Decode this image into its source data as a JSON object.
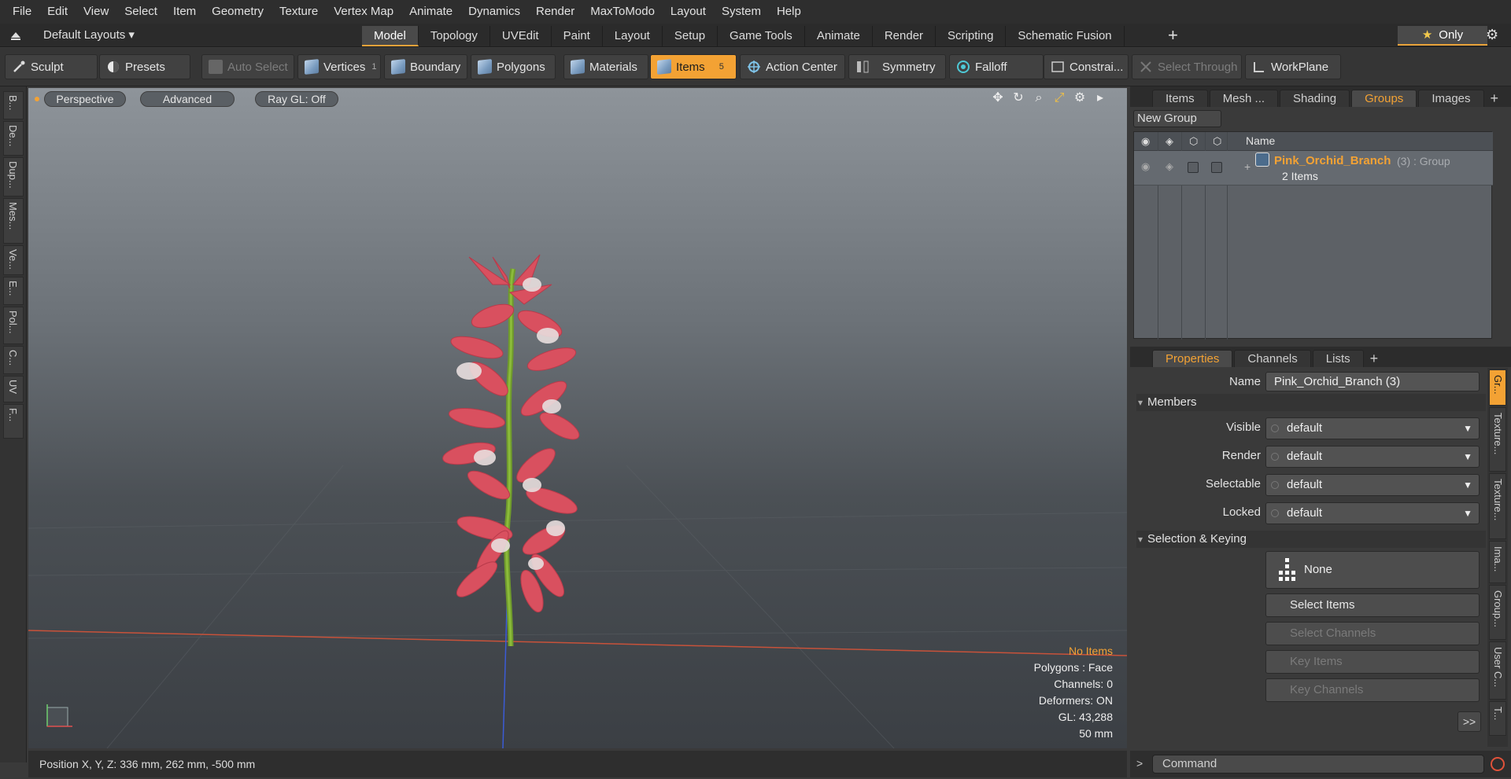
{
  "menubar": [
    "File",
    "Edit",
    "View",
    "Select",
    "Item",
    "Geometry",
    "Texture",
    "Vertex Map",
    "Animate",
    "Dynamics",
    "Render",
    "MaxToModo",
    "Layout",
    "System",
    "Help"
  ],
  "layouts": {
    "label": "Default Layouts ▾"
  },
  "layout_tabs": [
    "Model",
    "Topology",
    "UVEdit",
    "Paint",
    "Layout",
    "Setup",
    "Game Tools",
    "Animate",
    "Render",
    "Scripting",
    "Schematic Fusion"
  ],
  "layout_plus": "+",
  "only": {
    "label": "Only",
    "star": "★"
  },
  "toolbar": {
    "sculpt": "Sculpt",
    "presets": "Presets",
    "auto_select": "Auto Select",
    "vertices": "Vertices",
    "vertices_count": "1",
    "boundary": "Boundary",
    "polygons": "Polygons",
    "materials": "Materials",
    "items": "Items",
    "items_count": "5",
    "action_center": "Action Center",
    "symmetry": "Symmetry",
    "falloff": "Falloff",
    "constraints": "Constrai...",
    "select_through": "Select Through",
    "workplane": "WorkPlane"
  },
  "left_tabs": [
    "B...",
    "De...",
    "Dup...",
    "Mes...",
    "Ve...",
    "E...",
    "Pol...",
    "C...",
    "UV",
    "F..."
  ],
  "viewport": {
    "view": "Perspective",
    "style": "Advanced",
    "raygl": "Ray GL: Off",
    "info": {
      "warning": "No Items",
      "polygons": "Polygons : Face",
      "channels": "Channels: 0",
      "deformers": "Deformers: ON",
      "gl": "GL: 43,288",
      "scale": "50 mm"
    }
  },
  "top_right_tabs": [
    "Items",
    "Mesh ...",
    "Shading",
    "Groups",
    "Images"
  ],
  "groups": {
    "new_group": "New Group",
    "col_name": "Name",
    "row": {
      "name": "Pink_Orchid_Branch",
      "count": "(3) : Group",
      "items": "2 Items"
    }
  },
  "prop_tabs": [
    "Properties",
    "Channels",
    "Lists"
  ],
  "properties": {
    "name_label": "Name",
    "name_value": "Pink_Orchid_Branch (3)",
    "members": "Members",
    "visible_label": "Visible",
    "visible_value": "default",
    "render_label": "Render",
    "render_value": "default",
    "selectable_label": "Selectable",
    "selectable_value": "default",
    "locked_label": "Locked",
    "locked_value": "default",
    "selection_keying": "Selection & Keying",
    "none": "None",
    "select_items": "Select Items",
    "select_channels": "Select Channels",
    "key_items": "Key Items",
    "key_channels": "Key Channels",
    "more": ">>"
  },
  "right_vert_tabs": [
    "Gr...",
    "Texture...",
    "Texture...",
    "Ima...",
    "Group...",
    "User C...",
    "T..."
  ],
  "status": {
    "position": "Position X, Y, Z:   336 mm, 262 mm, -500 mm"
  },
  "command": {
    "chevron": ">",
    "placeholder": "Command"
  }
}
